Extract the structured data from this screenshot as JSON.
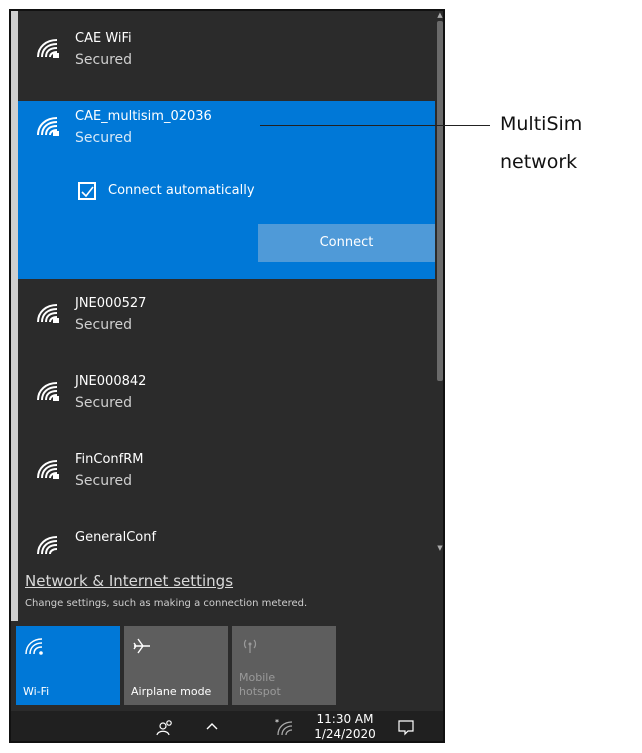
{
  "networks": [
    {
      "name": "CAE WiFi",
      "status": "Secured"
    },
    {
      "name": "CAE_multisim_02036",
      "status": "Secured",
      "selected": true
    },
    {
      "name": "JNE000527",
      "status": "Secured"
    },
    {
      "name": "JNE000842",
      "status": "Secured"
    },
    {
      "name": "FinConfRM",
      "status": "Secured"
    },
    {
      "name": "GeneralConf",
      "status": ""
    }
  ],
  "selected_network": {
    "connect_automatically_label": "Connect automatically",
    "connect_automatically_checked": true,
    "connect_label": "Connect"
  },
  "settings": {
    "link": "Network & Internet settings",
    "description": "Change settings, such as making a connection metered."
  },
  "quick_actions": [
    {
      "label": "Wi-Fi",
      "active": true,
      "icon": "wifi-icon"
    },
    {
      "label": "Airplane mode",
      "active": false,
      "icon": "airplane-icon"
    },
    {
      "label": "Mobile hotspot",
      "active": false,
      "disabled": true,
      "icon": "hotspot-icon"
    }
  ],
  "taskbar": {
    "time": "11:30 AM",
    "date": "1/24/2020"
  },
  "callout": {
    "line1": "MultiSim",
    "line2": "network"
  },
  "colors": {
    "panel_bg": "#2b2b2b",
    "accent": "#0078d7",
    "connect_button": "#4f9ad8",
    "tile_inactive": "#5e5e5e",
    "taskbar_bg": "#202020"
  }
}
